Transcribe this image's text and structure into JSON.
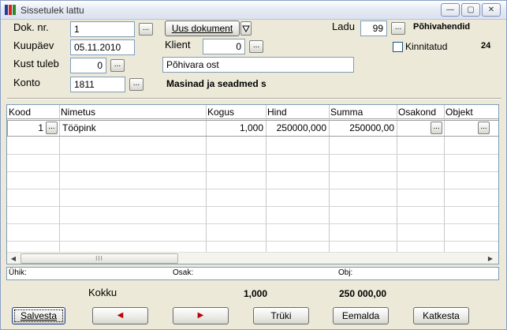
{
  "window": {
    "title": "Sissetulek lattu",
    "min_glyph": "—",
    "max_glyph": "▢",
    "close_glyph": "✕"
  },
  "form": {
    "dok_nr_label": "Dok. nr.",
    "dok_nr_value": "1",
    "kuupaev_label": "Kuupäev",
    "kuupaev_value": "05.11.2010",
    "kust_tuleb_label": "Kust tuleb",
    "kust_tuleb_value": "0",
    "konto_label": "Konto",
    "konto_value": "1811",
    "konto_desc": "Masinad ja seadmed s",
    "uus_dokument_label": "Uus dokument",
    "klient_label": "Klient",
    "klient_value": "0",
    "selgitus_value": "Põhivara ost",
    "ladu_label": "Ladu",
    "ladu_value": "99",
    "ladu_desc": "Põhivahendid",
    "kinnitatud_label": "Kinnitatud",
    "kinnitatud_count": "24",
    "ellipsis": "..."
  },
  "grid": {
    "columns": [
      "Kood",
      "Nimetus",
      "Kogus",
      "Hind",
      "Summa",
      "Osakond",
      "Objekt"
    ],
    "rows": [
      {
        "kood": "1",
        "nimetus": "Tööpink",
        "kogus": "1,000",
        "hind": "250000,000",
        "summa": "250000,00"
      }
    ],
    "scroll_left": "◀",
    "scroll_right": "▶",
    "scroll_thumb": "III"
  },
  "info": {
    "uhik_label": "Ühik:",
    "osak_label": "Osak:",
    "obj_label": "Obj:"
  },
  "totals": {
    "label": "Kokku",
    "kogus": "1,000",
    "summa": "250 000,00"
  },
  "buttons": {
    "save": "Salvesta",
    "prev": "◀",
    "next": "▶",
    "print": "Trüki",
    "remove": "Eemalda",
    "cancel": "Katkesta"
  },
  "colors": {
    "arrow_red": "#c00000",
    "window_bg": "#ece9d8"
  }
}
